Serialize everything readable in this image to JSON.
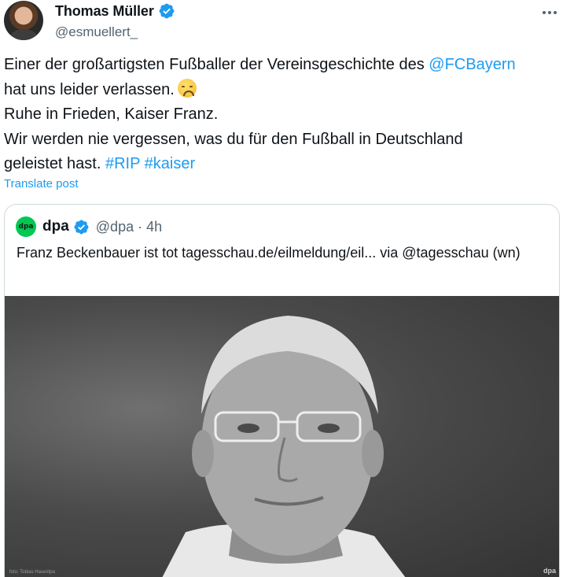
{
  "author": {
    "name": "Thomas Müller",
    "handle": "@esmuellert_"
  },
  "tweet": {
    "line1_text": "Einer der großartigsten Fußballer der Vereinsgeschichte des ",
    "line1_mention": "@FCBayern",
    "line2_text": "hat uns leider verlassen.",
    "line2_emoji": "disappointed-face",
    "line3": "Ruhe in Frieden, Kaiser Franz.",
    "line4": "Wir werden nie vergessen, was du für den Fußball in Deutschland",
    "line5_text": "geleistet hast. ",
    "hashtag1": "#RIP",
    "hashtag2": "#kaiser",
    "translate_label": "Translate post"
  },
  "quote": {
    "avatar_text": "dpa",
    "name": "dpa",
    "handle_time": "@dpa · 4h",
    "text": "Franz Beckenbauer ist tot tagesschau.de/eilmeldung/eil... via @tagesschau (wn)",
    "photo_credit": "foto: Tobias Hase/dpa",
    "photo_watermark": "dpa"
  },
  "colors": {
    "link": "#1d9bf0",
    "verified": "#1d9bf0",
    "secondary_text": "#536471",
    "dpa_green": "#00c853"
  }
}
